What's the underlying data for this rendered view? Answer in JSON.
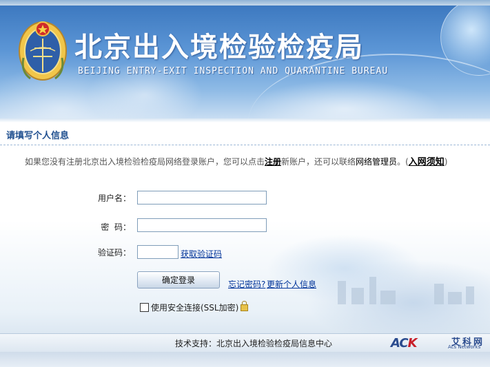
{
  "header": {
    "title_cn": "北京出入境检验检疫局",
    "title_en": "BEIJING ENTRY-EXIT INSPECTION AND QUARANTINE BUREAU",
    "emblem_icon": "national-emblem-icon"
  },
  "section": {
    "title": "请填写个人信息"
  },
  "notice": {
    "prefix": "如果您没有注册北京出入境检验检疫局网络登录账户，您可以点击",
    "register_link": "注册",
    "middle": "新账户，还可以联络",
    "admin_link": "网络管理员",
    "suffix_before": "。(",
    "rules_link": "入网须知",
    "suffix_after": ")"
  },
  "form": {
    "username_label": "用户名：",
    "username_value": "",
    "password_label": "密  码：",
    "password_value": "",
    "captcha_label": "验证码：",
    "captcha_value": "",
    "get_captcha_link": "获取验证码",
    "login_button": "确定登录",
    "forgot_password_link": "忘记密码?",
    "update_info_link": "更新个人信息",
    "ssl_checkbox_checked": false,
    "ssl_label": "使用安全连接(SSL加密)",
    "ssl_icon": "lock-icon"
  },
  "footer": {
    "support_text": "技术支持：北京出入境检验检疫局信息中心",
    "logo_mark_left": "AC",
    "logo_mark_k": "K",
    "logo_cn": "艾科网",
    "logo_en": "Acs Networks"
  },
  "colors": {
    "link": "#003399",
    "section_title": "#1f4f8f",
    "banner": "#5c96d6",
    "logo_red": "#c8202a"
  }
}
